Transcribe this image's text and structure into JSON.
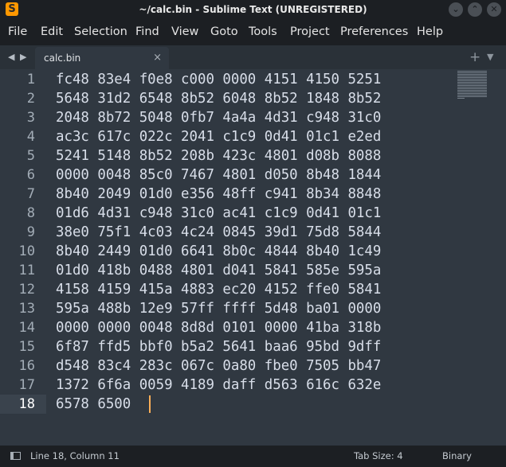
{
  "window": {
    "title": "~/calc.bin - Sublime Text (UNREGISTERED)",
    "app_icon_glyph": "S",
    "minimize_glyph": "⌄",
    "maximize_glyph": "⌃",
    "close_glyph": "✕"
  },
  "menu": {
    "items": [
      "File",
      "Edit",
      "Selection",
      "Find",
      "View",
      "Goto",
      "Tools",
      "Project",
      "Preferences",
      "Help"
    ]
  },
  "tabs": {
    "nav_left": "◀",
    "nav_right": "▶",
    "items": [
      {
        "label": "calc.bin",
        "close": "×",
        "active": true
      }
    ],
    "add_glyph": "+",
    "menu_glyph": "▼"
  },
  "editor": {
    "active_line": 18,
    "lines": [
      "fc48 83e4 f0e8 c000 0000 4151 4150 5251",
      "5648 31d2 6548 8b52 6048 8b52 1848 8b52",
      "2048 8b72 5048 0fb7 4a4a 4d31 c948 31c0",
      "ac3c 617c 022c 2041 c1c9 0d41 01c1 e2ed",
      "5241 5148 8b52 208b 423c 4801 d08b 8088",
      "0000 0048 85c0 7467 4801 d050 8b48 1844",
      "8b40 2049 01d0 e356 48ff c941 8b34 8848",
      "01d6 4d31 c948 31c0 ac41 c1c9 0d41 01c1",
      "38e0 75f1 4c03 4c24 0845 39d1 75d8 5844",
      "8b40 2449 01d0 6641 8b0c 4844 8b40 1c49",
      "01d0 418b 0488 4801 d041 5841 585e 595a",
      "4158 4159 415a 4883 ec20 4152 ffe0 5841",
      "595a 488b 12e9 57ff ffff 5d48 ba01 0000",
      "0000 0000 0048 8d8d 0101 0000 41ba 318b",
      "6f87 ffd5 bbf0 b5a2 5641 baa6 95bd 9dff",
      "d548 83c4 283c 067c 0a80 fbe0 7505 bb47",
      "1372 6f6a 0059 4189 daff d563 616c 632e",
      "6578 6500"
    ],
    "caret_color": "#f9ae58"
  },
  "status": {
    "position": "Line 18, Column 11",
    "tab_size": "Tab Size: 4",
    "syntax": "Binary"
  }
}
